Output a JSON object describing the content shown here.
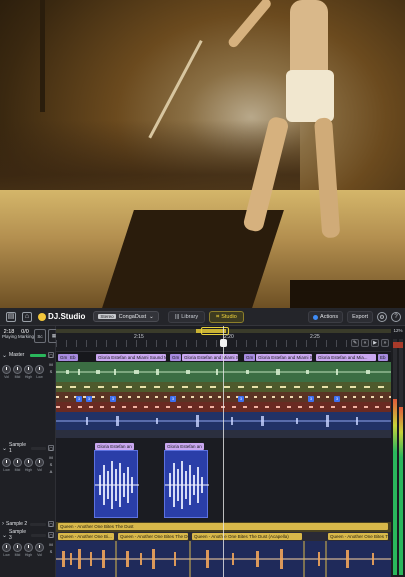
{
  "video": {},
  "app": {
    "logo": "DJ.Studio",
    "mix_badge": "Stereo",
    "mix_name": "CongaDust",
    "tabs": [
      {
        "label": "Library",
        "active": false
      },
      {
        "label": "Studio",
        "active": true
      }
    ],
    "actions_label": "Actions",
    "export_label": "Export",
    "counters": [
      {
        "value": "2:18",
        "label": "Playing"
      },
      {
        "value": "0/0",
        "label": "Marking"
      }
    ],
    "sync_label": "Sc",
    "zoom_label": "12%"
  },
  "ruler": {
    "labels": [
      "2:15",
      "2:20",
      "2:25"
    ]
  },
  "decks": [
    {
      "name": "Master",
      "knobs": [
        "Vol",
        "Mid",
        "High",
        "Low"
      ],
      "side": [
        "M",
        "S"
      ]
    },
    {
      "name": "Sample 1",
      "knobs": [
        "Low",
        "Mid",
        "High",
        "Vol"
      ],
      "side": [
        "M",
        "S",
        "A"
      ]
    },
    {
      "name": "Sample 2",
      "knobs": [],
      "side": []
    },
    {
      "name": "Sample 3",
      "knobs": [
        "Low",
        "Mid",
        "High",
        "Vol"
      ],
      "side": [
        "M",
        "S"
      ]
    }
  ],
  "master_segments": [
    "Gloria Estefan and Miami Sound Machine ...",
    "Gloria Estefan and Miami Sound ...",
    "Gloria Estefan and Miami Sound ...",
    "Gloria Estefan and Mia..."
  ],
  "master_tags": [
    "Gm",
    "Eb",
    "Gm",
    "Gm",
    "Eb"
  ],
  "sample1_clips": [
    "Gloria Estefan an",
    "Gloria Estefan an"
  ],
  "sample2_label": "Queen - Another One Bites The Dust",
  "sample3_segments": [
    "Queen - Another One Bi...",
    "Queen - Another One Bites The Dust",
    "Queen - Anoth e One Bites The Dust (Acapella)",
    "Queen - Another One Bites The Dust"
  ],
  "markers": [
    "3",
    "3",
    "3",
    "3",
    "3",
    "3",
    "3"
  ]
}
